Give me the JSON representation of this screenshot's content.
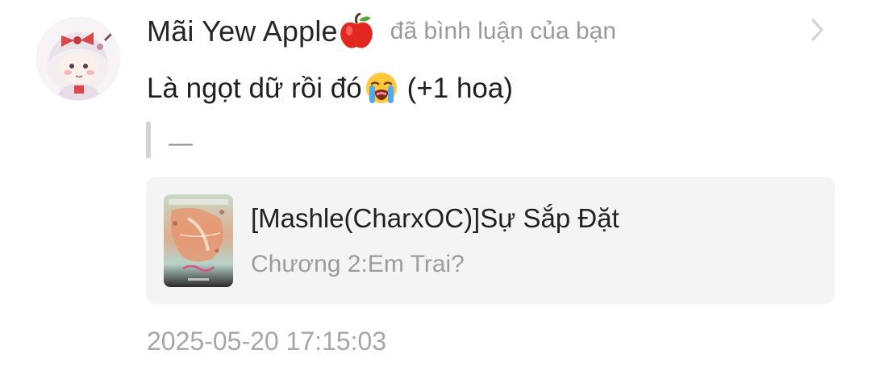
{
  "notification": {
    "user": {
      "name": "Mãi Yew Apple",
      "name_emoji_icon": "red-apple-icon",
      "avatar_icon": "anime-chibi-avatar"
    },
    "action_text": "đã bình luận của bạn",
    "comment": {
      "text_before_emoji": "Là ngọt dữ rồi đó",
      "emoji_icon": "loudly-crying-face-icon",
      "text_after_emoji": "(+1 hoa)"
    },
    "quoted_text": "—",
    "story": {
      "title": "[Mashle(CharxOC)]Sự Sắp Đặt",
      "chapter": "Chương 2:Em Trai?",
      "cover_icon": "story-cover-image"
    },
    "timestamp": "2025-05-20 17:15:03",
    "colors": {
      "username": "#262626",
      "secondary_text": "#9a9a9a",
      "card_background": "#f4f4f5",
      "quote_bar": "#d4d4d4"
    }
  }
}
